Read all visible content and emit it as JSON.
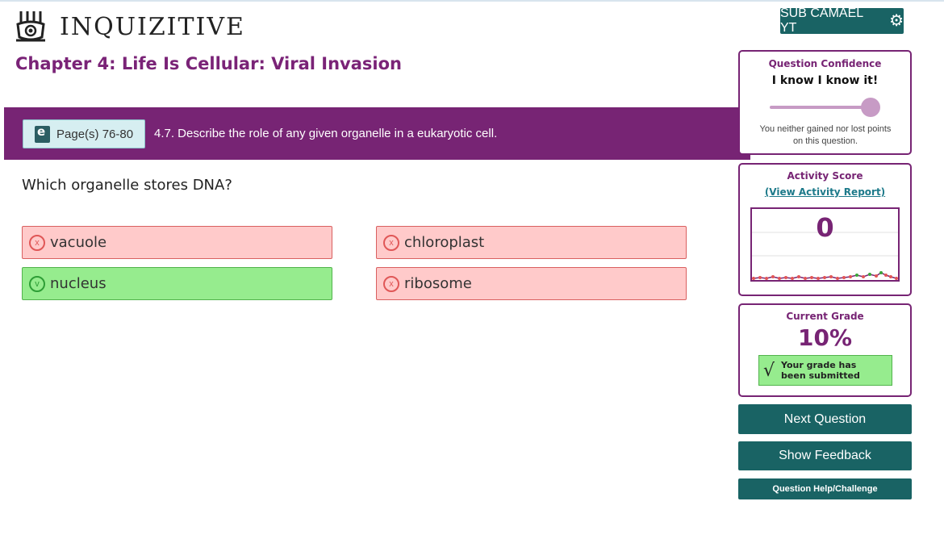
{
  "header": {
    "app_name": "INQUIZITIVE",
    "user_button_label": "SUB CAMAEL YT"
  },
  "chapter": {
    "title": "Chapter 4: Life Is Cellular: Viral Invasion"
  },
  "objective": {
    "pages_label": "Page(s) 76-80",
    "text": "4.7. Describe the role of any given organelle in a eukaryotic cell."
  },
  "question": {
    "text": "Which organelle stores DNA?",
    "answers": [
      {
        "label": "vacuole",
        "status": "incorrect",
        "mark": "x"
      },
      {
        "label": "chloroplast",
        "status": "incorrect",
        "mark": "x"
      },
      {
        "label": "nucleus",
        "status": "correct",
        "mark": "v"
      },
      {
        "label": "ribosome",
        "status": "incorrect",
        "mark": "x"
      }
    ]
  },
  "confidence": {
    "title": "Question Confidence",
    "level_text": "I know I know it!",
    "slider_level": 1.0,
    "note": "You neither gained nor lost points on this question."
  },
  "activity": {
    "title": "Activity Score",
    "report_link": "(View Activity Report)",
    "score": "0"
  },
  "grade": {
    "title": "Current Grade",
    "value": "10%",
    "submitted_text": "Your grade has been submitted"
  },
  "actions": {
    "next_label": "Next Question",
    "feedback_label": "Show Feedback",
    "help_label": "Question Help/Challenge"
  },
  "colors": {
    "brand_purple": "#772474",
    "teal": "#196364",
    "correct_bg": "#96ec8e",
    "incorrect_bg": "#ffcaca"
  }
}
